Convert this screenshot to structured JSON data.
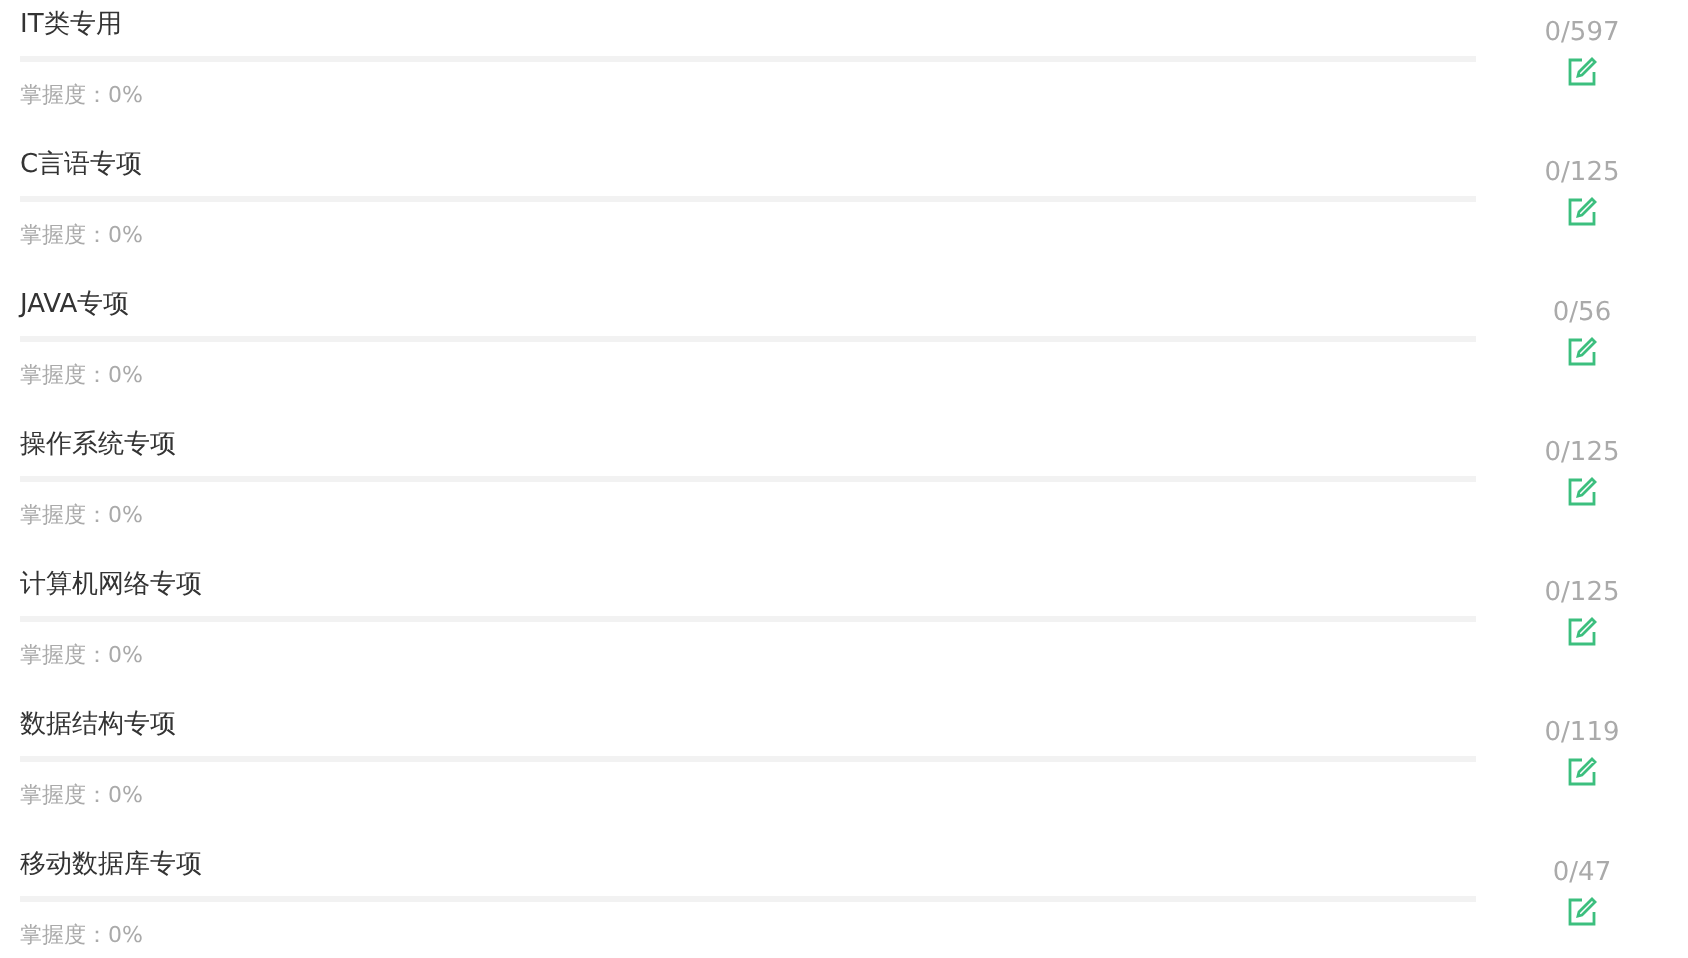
{
  "subjects": [
    {
      "title": "IT类专用",
      "mastery": "掌握度：0%",
      "level": 0,
      "count": "0/597"
    },
    {
      "title": "C言语专项",
      "mastery": "掌握度：0%",
      "level": 0,
      "count": "0/125"
    },
    {
      "title": "JAVA专项",
      "mastery": "掌握度：0%",
      "level": 0,
      "count": "0/56"
    },
    {
      "title": "操作系统专项",
      "mastery": "掌握度：0%",
      "level": 0,
      "count": "0/125"
    },
    {
      "title": "计算机网络专项",
      "mastery": "掌握度：0%",
      "level": 0,
      "count": "0/125"
    },
    {
      "title": "数据结构专项",
      "mastery": "掌握度：0%",
      "level": 0,
      "count": "0/119"
    },
    {
      "title": "移动数据库专项",
      "mastery": "掌握度：0%",
      "level": 0,
      "count": "0/47"
    }
  ]
}
